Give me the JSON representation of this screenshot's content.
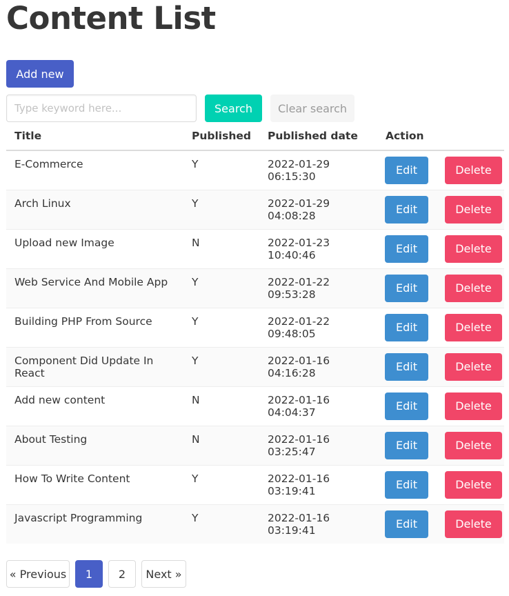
{
  "page": {
    "title": "Content List"
  },
  "toolbar": {
    "add_label": "Add new",
    "search_placeholder": "Type keyword here...",
    "search_value": "",
    "search_label": "Search",
    "clear_label": "Clear search"
  },
  "table": {
    "headers": [
      "Title",
      "Published",
      "Published date",
      "Action"
    ],
    "rows": [
      {
        "title": "E-Commerce",
        "published": "Y",
        "date": "2022-01-29 06:15:30"
      },
      {
        "title": "Arch Linux",
        "published": "Y",
        "date": "2022-01-29 04:08:28"
      },
      {
        "title": "Upload new Image",
        "published": "N",
        "date": "2022-01-23 10:40:46"
      },
      {
        "title": "Web Service And Mobile App",
        "published": "Y",
        "date": "2022-01-22 09:53:28"
      },
      {
        "title": "Building PHP From Source",
        "published": "Y",
        "date": "2022-01-22 09:48:05"
      },
      {
        "title": "Component Did Update In React",
        "published": "Y",
        "date": "2022-01-16 04:16:28"
      },
      {
        "title": "Add new content",
        "published": "N",
        "date": "2022-01-16 04:04:37"
      },
      {
        "title": "About Testing",
        "published": "N",
        "date": "2022-01-16 03:25:47"
      },
      {
        "title": "How To Write Content",
        "published": "Y",
        "date": "2022-01-16 03:19:41"
      },
      {
        "title": "Javascript Programming",
        "published": "Y",
        "date": "2022-01-16 03:19:41"
      }
    ],
    "edit_label": "Edit",
    "delete_label": "Delete"
  },
  "pagination": {
    "previous_label": "« Previous",
    "pages": [
      "1",
      "2"
    ],
    "current_page": "1",
    "next_label": "Next »"
  },
  "colors": {
    "primary": "#485fc7",
    "search": "#00d1b2",
    "edit": "#3e8ed0",
    "delete": "#f14668"
  }
}
